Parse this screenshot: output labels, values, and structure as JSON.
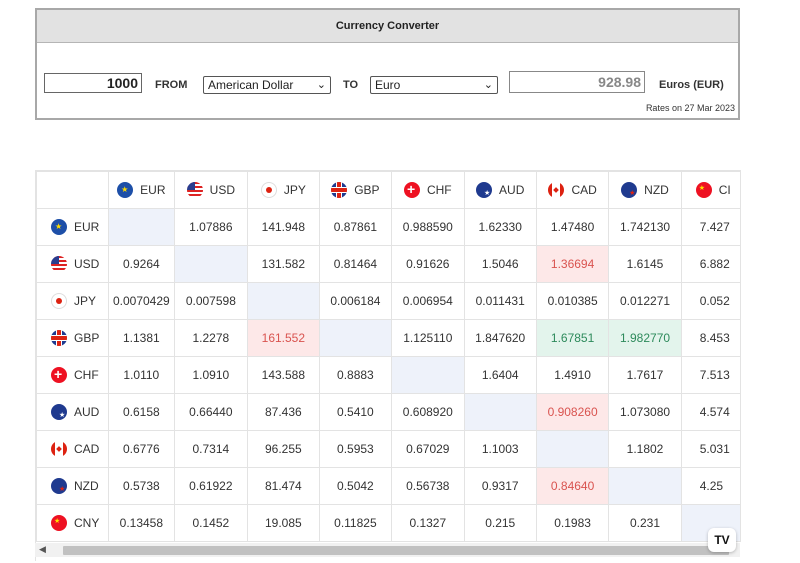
{
  "converter": {
    "title": "Currency Converter",
    "amount": "1000",
    "from_label": "FROM",
    "from_currency": "American Dollar",
    "to_label": "TO",
    "to_currency": "Euro",
    "result": "928.98",
    "result_unit": "Euros (EUR)",
    "rates_note": "Rates on 27 Mar 2023"
  },
  "cross_rates": {
    "columns": [
      "EUR",
      "USD",
      "JPY",
      "GBP",
      "CHF",
      "AUD",
      "CAD",
      "NZD",
      "CNY"
    ],
    "visible_columns": [
      "EUR",
      "USD",
      "JPY",
      "GBP",
      "CHF",
      "AUD",
      "CAD",
      "NZD",
      "CI"
    ],
    "rows": [
      {
        "code": "EUR",
        "flag": "eu-flag-icon",
        "cells": [
          "",
          "1.07886",
          "141.948",
          "0.87861",
          "0.988590",
          "1.62330",
          "1.47480",
          "1.742130",
          "7.427"
        ]
      },
      {
        "code": "USD",
        "flag": "us-flag-icon",
        "cells": [
          "0.9264",
          "",
          "131.582",
          "0.81464",
          "0.91626",
          "1.5046",
          "1.36694",
          "1.6145",
          "6.882"
        ]
      },
      {
        "code": "JPY",
        "flag": "jp-flag-icon",
        "cells": [
          "0.0070429",
          "0.007598",
          "",
          "0.006184",
          "0.006954",
          "0.011431",
          "0.010385",
          "0.012271",
          "0.052"
        ]
      },
      {
        "code": "GBP",
        "flag": "gb-flag-icon",
        "cells": [
          "1.1381",
          "1.2278",
          "161.552",
          "",
          "1.125110",
          "1.847620",
          "1.67851",
          "1.982770",
          "8.453"
        ]
      },
      {
        "code": "CHF",
        "flag": "ch-flag-icon",
        "cells": [
          "1.0110",
          "1.0910",
          "143.588",
          "0.8883",
          "",
          "1.6404",
          "1.4910",
          "1.7617",
          "7.513"
        ]
      },
      {
        "code": "AUD",
        "flag": "au-flag-icon",
        "cells": [
          "0.6158",
          "0.66440",
          "87.436",
          "0.5410",
          "0.608920",
          "",
          "0.908260",
          "1.073080",
          "4.574"
        ]
      },
      {
        "code": "CAD",
        "flag": "ca-flag-icon",
        "cells": [
          "0.6776",
          "0.7314",
          "96.255",
          "0.5953",
          "0.67029",
          "1.1003",
          "",
          "1.1802",
          "5.031"
        ]
      },
      {
        "code": "NZD",
        "flag": "nz-flag-icon",
        "cells": [
          "0.5738",
          "0.61922",
          "81.474",
          "0.5042",
          "0.56738",
          "0.9317",
          "0.84640",
          "",
          "4.25"
        ]
      },
      {
        "code": "CNY",
        "flag": "cn-flag-icon",
        "cells": [
          "0.13458",
          "0.1452",
          "19.085",
          "0.11825",
          "0.1327",
          "0.215",
          "0.1983",
          "0.231",
          ""
        ]
      }
    ],
    "highlights": {
      "negative": [
        [
          1,
          6
        ],
        [
          3,
          2
        ],
        [
          5,
          6
        ],
        [
          7,
          6
        ]
      ],
      "positive": [
        [
          3,
          6
        ],
        [
          3,
          7
        ]
      ],
      "colors": {
        "negative_bg": "#fde8e8",
        "negative_text": "#d9534f",
        "positive_bg": "#e3f4ec",
        "positive_text": "#2d8a5b",
        "diagonal_bg": "#eef2fa"
      }
    }
  },
  "footer": {
    "brand_badge": "TV",
    "scroll_left_icon": "chevron-left-icon"
  }
}
